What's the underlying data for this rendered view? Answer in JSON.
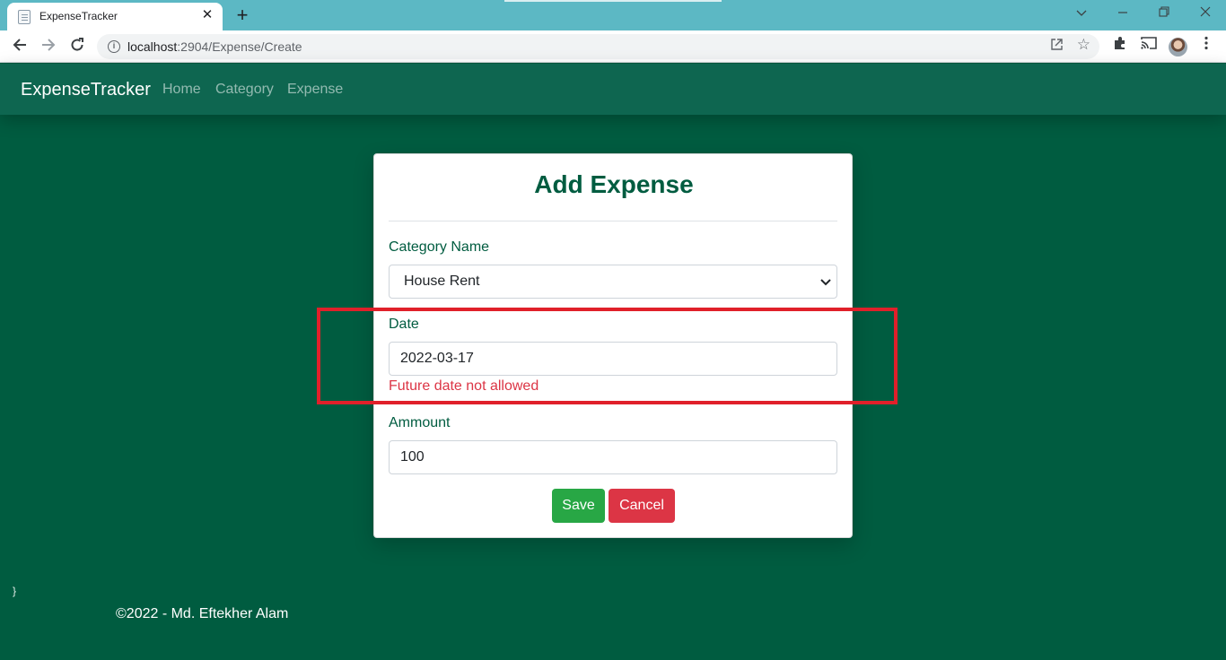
{
  "browser": {
    "tab_title": "ExpenseTracker",
    "tab_close_glyph": "✕",
    "new_tab_glyph": "+",
    "url_host": "localhost",
    "url_rest": ":2904/Expense/Create",
    "icons": [
      "back-arrow-icon",
      "forward-arrow-icon",
      "reload-icon",
      "info-icon",
      "share-icon",
      "star-icon",
      "extensions-icon",
      "cast-icon",
      "profile-avatar",
      "menu-icon"
    ],
    "window_controls": [
      "chevron-down-icon",
      "minimize-icon",
      "restore-icon",
      "close-icon"
    ]
  },
  "navbar": {
    "brand": "ExpenseTracker",
    "links": [
      "Home",
      "Category",
      "Expense"
    ]
  },
  "form": {
    "title": "Add Expense",
    "category_label": "Category Name",
    "category_value": "House Rent",
    "date_label": "Date",
    "date_value": "2022-03-17",
    "date_error": "Future date not allowed",
    "amount_label": "Ammount",
    "amount_value": "100",
    "save_label": "Save",
    "cancel_label": "Cancel"
  },
  "stray_text": "}",
  "footer": {
    "text": "©2022 - Md. Eftekher Alam"
  },
  "colors": {
    "page_bg": "#005c40",
    "navbar_bg": "#0e6650",
    "title_green": "#005c40",
    "save_green": "#28a745",
    "cancel_red": "#dc3545",
    "highlight_red": "#e0202a",
    "tabstrip": "#5cb8c4"
  }
}
